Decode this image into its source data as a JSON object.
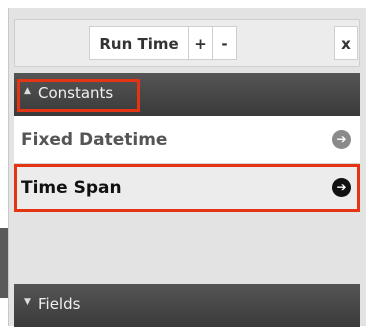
{
  "toolbar": {
    "run_time_label": "Run Time",
    "plus_label": "+",
    "minus_label": "-",
    "close_label": "x"
  },
  "constants_section": {
    "caret": "▲",
    "label": "Constants",
    "items": [
      {
        "label": "Fixed Datetime",
        "arrow": "➔"
      },
      {
        "label": "Time Span",
        "arrow": "➔"
      }
    ]
  },
  "fields_section": {
    "caret": "▼",
    "label": "Fields"
  },
  "colors": {
    "highlight": "#e43414",
    "header_bg": "#474747"
  },
  "icons": {
    "item_arrow": "circle-arrow-right-icon",
    "constants_caret": "caret-up-icon",
    "fields_caret": "caret-down-icon"
  }
}
